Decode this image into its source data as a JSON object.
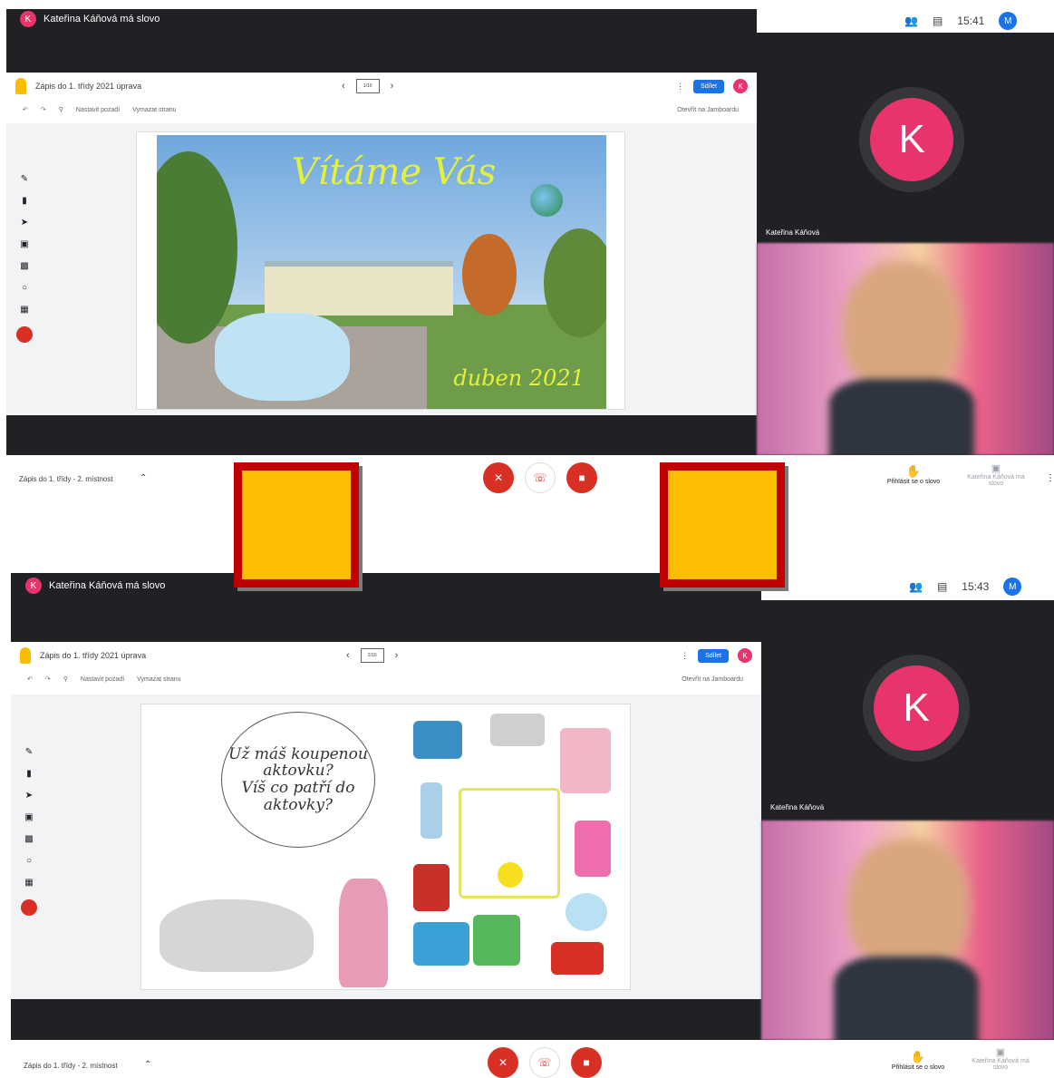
{
  "colors": {
    "accent": "#e8336d",
    "meet_dark": "#202124",
    "brand_blue": "#1a73e8",
    "marker_fill": "#fdbd00",
    "marker_border": "#c00000"
  },
  "screens": [
    {
      "speaker": "Kateřina Káňová má slovo",
      "avatar_letter": "K",
      "clock": "15:41",
      "me_letter": "M",
      "jam": {
        "doc_title": "Zápis do 1. třídy 2021 úprava",
        "thumb_label": "1/10",
        "share": "Sdílet",
        "set_bg": "Nastavit pozadí",
        "clear": "Vymazat stranu",
        "open": "Otevřít na Jamboardu"
      },
      "slide": {
        "title": "Vítáme Vás",
        "date": "duben 2021"
      },
      "tile_name": "Kateřina Káňová",
      "bottom": {
        "meeting": "Zápis do 1. třídy - 2. místnost",
        "raise": "Přihlásit se o slovo",
        "present": "Kateřina Káňová má slovo"
      }
    },
    {
      "speaker": "Kateřina Káňová má slovo",
      "avatar_letter": "K",
      "clock": "15:43",
      "me_letter": "M",
      "jam": {
        "doc_title": "Zápis do 1. třídy 2021 úprava",
        "thumb_label": "2/10",
        "share": "Sdílet",
        "set_bg": "Nastavit pozadí",
        "clear": "Vymazat stranu",
        "open": "Otevřít na Jamboardu"
      },
      "slide": {
        "bubble_line1": "Už máš koupenou",
        "bubble_line2": "aktovku?",
        "bubble_line3": "Víš co patří do",
        "bubble_line4": "aktovky?"
      },
      "tile_name": "Kateřina Káňová",
      "bottom": {
        "meeting": "Zápis do 1. třídy - 2. místnost",
        "raise": "Přihlásit se o slovo",
        "present": "Kateřina Káňová má slovo"
      }
    }
  ],
  "icons": [
    "people-icon",
    "chat-icon",
    "undo-icon",
    "redo-icon",
    "zoom-icon",
    "pen-icon",
    "eraser-icon",
    "select-icon",
    "sticky-note-icon",
    "image-icon",
    "circle-icon",
    "text-box-icon",
    "laser-icon",
    "mic-off-icon",
    "hang-up-icon",
    "camera-off-icon",
    "hand-icon",
    "present-icon"
  ]
}
